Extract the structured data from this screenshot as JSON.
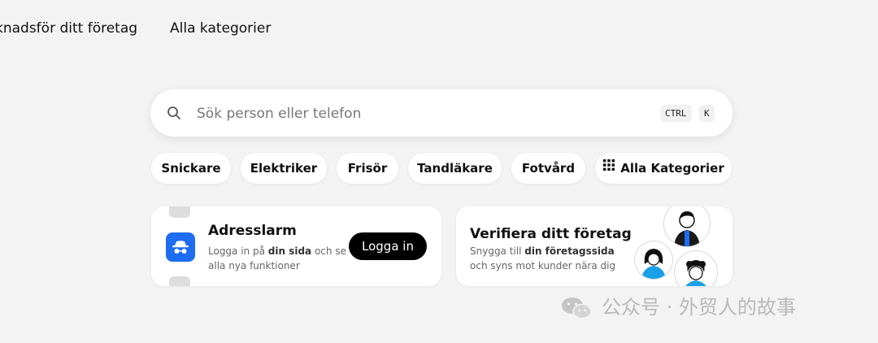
{
  "nav": {
    "items": [
      "knadsför ditt företag",
      "Alla kategorier"
    ]
  },
  "search": {
    "placeholder": "Sök person eller telefon",
    "shortcut_keys": [
      "CTRL",
      "K"
    ],
    "icon": "search-icon"
  },
  "categories": {
    "chips": [
      "Snickare",
      "Elektriker",
      "Frisör",
      "Tandläkare",
      "Fotvård"
    ],
    "all_label": "Alla Kategorier",
    "all_icon": "grid-icon"
  },
  "cards": [
    {
      "title": "Adresslarm",
      "desc_prefix": "Logga in på ",
      "desc_bold": "din sida",
      "desc_suffix": " och se alla nya funktioner",
      "button": "Logga in",
      "icon": "spy-icon",
      "accent": "#1d6cf2"
    },
    {
      "title": "Verifiera ditt företag",
      "desc_prefix": "Snygga till ",
      "desc_bold": "din företagssida",
      "desc_suffix": " och syns mot kunder nära dig",
      "avatars": [
        "person-avatar",
        "person-avatar",
        "person-avatar"
      ]
    }
  ],
  "watermark": {
    "text": "公众号 · 外贸人的故事",
    "icon": "wechat-icon"
  },
  "colors": {
    "background": "#f3f3f3",
    "accent_blue": "#1d6cf2",
    "button_black": "#000000"
  }
}
